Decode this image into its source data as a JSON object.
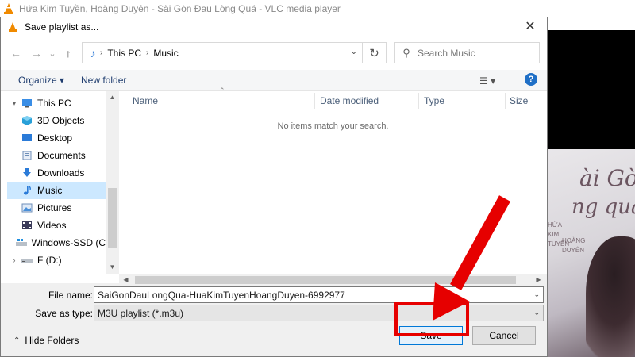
{
  "vlc": {
    "window_title": "Hứa Kim Tuyền, Hoàng Duyên - Sài Gòn Đau Lòng Quá - VLC media player",
    "art_line1": "ài Gòn",
    "art_line2": "ng quá!",
    "art_vertical_artist1": "HỨA KIM TUYỀN",
    "art_vertical_artist2": "HOÀNG DUYÊN"
  },
  "dialog": {
    "title": "Save playlist as...",
    "close_glyph": "✕",
    "nav": {
      "back_glyph": "←",
      "forward_glyph": "→",
      "recent_glyph": "⌄",
      "up_glyph": "↑",
      "address_icon": "♪",
      "breadcrumb": [
        "This PC",
        "Music"
      ],
      "refresh_glyph": "↻",
      "search_placeholder": "Search Music"
    },
    "toolbar": {
      "organize": "Organize ▾",
      "new_folder": "New folder",
      "views_glyph": "☰ ▾",
      "help_glyph": "?"
    },
    "sidebar": {
      "items": [
        {
          "label": "This PC",
          "icon": "computer-icon",
          "selected": false
        },
        {
          "label": "3D Objects",
          "icon": "cube-icon",
          "selected": false
        },
        {
          "label": "Desktop",
          "icon": "desktop-icon",
          "selected": false
        },
        {
          "label": "Documents",
          "icon": "document-icon",
          "selected": false
        },
        {
          "label": "Downloads",
          "icon": "download-icon",
          "selected": false
        },
        {
          "label": "Music",
          "icon": "music-icon",
          "selected": true
        },
        {
          "label": "Pictures",
          "icon": "pictures-icon",
          "selected": false
        },
        {
          "label": "Videos",
          "icon": "videos-icon",
          "selected": false
        },
        {
          "label": "Windows-SSD (C",
          "icon": "drive-icon",
          "selected": false
        },
        {
          "label": "F (D:)",
          "icon": "drive-icon",
          "selected": false
        }
      ]
    },
    "columns": [
      "Name",
      "Date modified",
      "Type",
      "Size"
    ],
    "empty_message": "No items match your search.",
    "form": {
      "file_name_label": "File name:",
      "file_name_value": "SaiGonDauLongQua-HuaKimTuyenHoangDuyen-6992977",
      "save_as_type_label": "Save as type:",
      "save_as_type_value": "M3U playlist (*.m3u)"
    },
    "footer": {
      "hide_folders": "Hide Folders",
      "save": "Save",
      "cancel": "Cancel"
    }
  },
  "colors": {
    "highlight": "#e60000",
    "selected_nav": "#cce8ff",
    "primary_border": "#0078d7"
  }
}
